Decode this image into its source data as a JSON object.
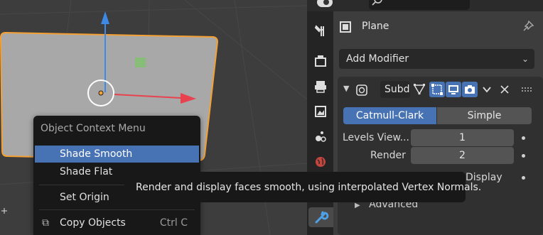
{
  "viewport": {
    "context_menu": {
      "title": "Object Context Menu",
      "items": [
        {
          "label": "Shade Smooth",
          "highlighted": true
        },
        {
          "label": "Shade Flat",
          "highlighted": false
        },
        {
          "label": "Set Origin",
          "highlighted": false
        },
        {
          "label": "Copy Objects",
          "shortcut": "Ctrl C",
          "highlighted": false
        }
      ]
    },
    "tooltip": "Render and display faces smooth, using interpolated Vertex Normals."
  },
  "properties": {
    "tabs": [
      "tool-icon",
      "render-icon",
      "output-icon",
      "view-layer-icon",
      "scene-icon",
      "world-icon",
      "modifier-wrench-icon"
    ],
    "active_tab": "modifier-wrench-icon",
    "object_name": "Plane",
    "add_modifier_label": "Add Modifier",
    "modifier": {
      "name": "Subd",
      "algorithms": [
        "Catmull-Clark",
        "Simple"
      ],
      "selected_algorithm": "Catmull-Clark",
      "fields": [
        {
          "label": "Levels View...",
          "value": "1"
        },
        {
          "label": "Render",
          "value": "2"
        }
      ],
      "optimal_display_label": "Display",
      "advanced_label": "Advanced"
    }
  },
  "colors": {
    "accent": "#4772b3",
    "selection_outline": "#f5a033",
    "axis_x": "#e8424f",
    "axis_z": "#3d8ae6"
  }
}
